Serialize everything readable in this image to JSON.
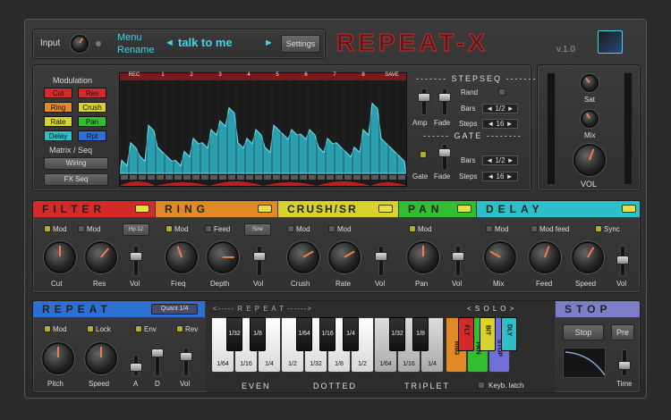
{
  "top": {
    "input_label": "Input",
    "menu_label": "Menu",
    "rename_label": "Rename",
    "preset_prev": "◄",
    "preset_name": "talk to me",
    "preset_next": "►",
    "settings_label": "Settings",
    "brand": "REPEAT-X",
    "version": "v.1.0"
  },
  "modulation": {
    "title": "Modulation",
    "buttons": [
      {
        "label": "Cut",
        "color": "#d42a2a"
      },
      {
        "label": "Res",
        "color": "#d42a2a"
      },
      {
        "label": "Ring",
        "color": "#e28a25"
      },
      {
        "label": "Crush",
        "color": "#d9d22c"
      },
      {
        "label": "Rate",
        "color": "#d9d22c"
      },
      {
        "label": "Pan",
        "color": "#2fbf2f"
      },
      {
        "label": "Delay",
        "color": "#2ec0c8"
      },
      {
        "label": "Rpt",
        "color": "#2e6fd4"
      }
    ],
    "matrix_label": "Matrix / Seq",
    "wiring_label": "Wiring",
    "fxseq_label": "FX Seq"
  },
  "sequencer": {
    "header_labels": [
      "REC",
      "1",
      "2",
      "3",
      "4",
      "5",
      "6",
      "7",
      "8",
      "SAVE"
    ],
    "step_values": [
      0.15,
      0.35,
      0.2,
      0.55,
      0.3,
      0.2,
      0.15,
      0.25,
      0.4,
      0.35,
      0.5,
      0.6,
      0.75,
      0.35,
      0.4,
      0.5,
      0.3,
      0.55,
      0.45,
      0.5,
      0.45,
      0.5,
      0.3,
      0.4,
      0.35,
      0.25,
      0.3,
      0.5,
      0.8,
      0.4,
      0.3,
      0.2
    ]
  },
  "stepseq": {
    "title": "STEPSEQ",
    "amp_label": "Amp",
    "fade_label": "Fade",
    "rand_label": "Rand",
    "bars_label": "Bars",
    "bars_value": "1/2",
    "steps_label": "Steps",
    "steps_value": "16"
  },
  "gate": {
    "title": "GATE",
    "gate_label": "Gate",
    "fade_label": "Fade",
    "bars_label": "Bars",
    "bars_value": "1/2",
    "steps_label": "Steps",
    "steps_value": "16"
  },
  "output": {
    "sat_label": "Sat",
    "mix_label": "Mix",
    "vol_label": "VOL"
  },
  "filter": {
    "title": "FILTER",
    "color": "#d42a2a",
    "mod1": "Mod",
    "mod2": "Mod",
    "type": "Hp 12",
    "cut": "Cut",
    "res": "Res",
    "vol": "Vol"
  },
  "ring": {
    "title": "RING",
    "color": "#e28a25",
    "mod": "Mod",
    "feed": "Feed",
    "wave": "Sine",
    "freq": "Freq",
    "depth": "Depth",
    "vol": "Vol"
  },
  "crush": {
    "title": "CRUSH/SR",
    "color": "#d9d22c",
    "mod1": "Mod",
    "mod2": "Mod",
    "crush": "Crush",
    "rate": "Rate",
    "vol": "Vol"
  },
  "pan": {
    "title": "PAN",
    "color": "#2fbf2f",
    "mod": "Mod",
    "pan": "Pan",
    "vol": "Vol"
  },
  "delay": {
    "title": "DELAY",
    "color": "#2ec0c8",
    "mod": "Mod",
    "modfeed": "Mod feed",
    "sync": "Sync",
    "mix": "Mix",
    "feed": "Feed",
    "speed": "Speed",
    "vol": "Vol"
  },
  "repeat": {
    "title": "REPEAT",
    "color": "#2e6fd4",
    "quant": "Quant 1/4",
    "mod": "Mod",
    "lock": "Lock",
    "env": "Env",
    "rev": "Rev",
    "pitch": "Pitch",
    "speed": "Speed",
    "a": "A",
    "d": "D",
    "vol": "Vol"
  },
  "keyboard": {
    "header_left": "<----- R   E   P   E   A   T ------>",
    "header_right": "< S O L O >",
    "black_keys": [
      "1/32",
      "1/8",
      "1/64",
      "1/16",
      "1/4",
      "1/32",
      "1/8"
    ],
    "white_keys": [
      "1/64",
      "1/16",
      "1/4",
      "1/2",
      "1/32",
      "1/8",
      "1/2",
      "1/64",
      "1/16",
      "1/4"
    ],
    "solo_top": [
      {
        "label": "FLT",
        "color": "#d42a2a"
      },
      {
        "label": "BIT",
        "color": "#d9d22c"
      },
      {
        "label": "DLY",
        "color": "#2ec0c8"
      }
    ],
    "solo_bottom": [
      {
        "label": "RNG",
        "color": "#e28a25"
      },
      {
        "label": "PAN",
        "color": "#2fbf2f"
      },
      {
        "label": "STOP",
        "color": "#6f6fd8"
      }
    ],
    "even": "EVEN",
    "dotted": "DOTTED",
    "triplet": "TRIPLET",
    "keyb_latch": "Keyb. latch"
  },
  "stop": {
    "title": "STOP",
    "color": "#7e7ec8",
    "stop_label": "Stop",
    "pre_label": "Pre",
    "time_label": "Time"
  }
}
